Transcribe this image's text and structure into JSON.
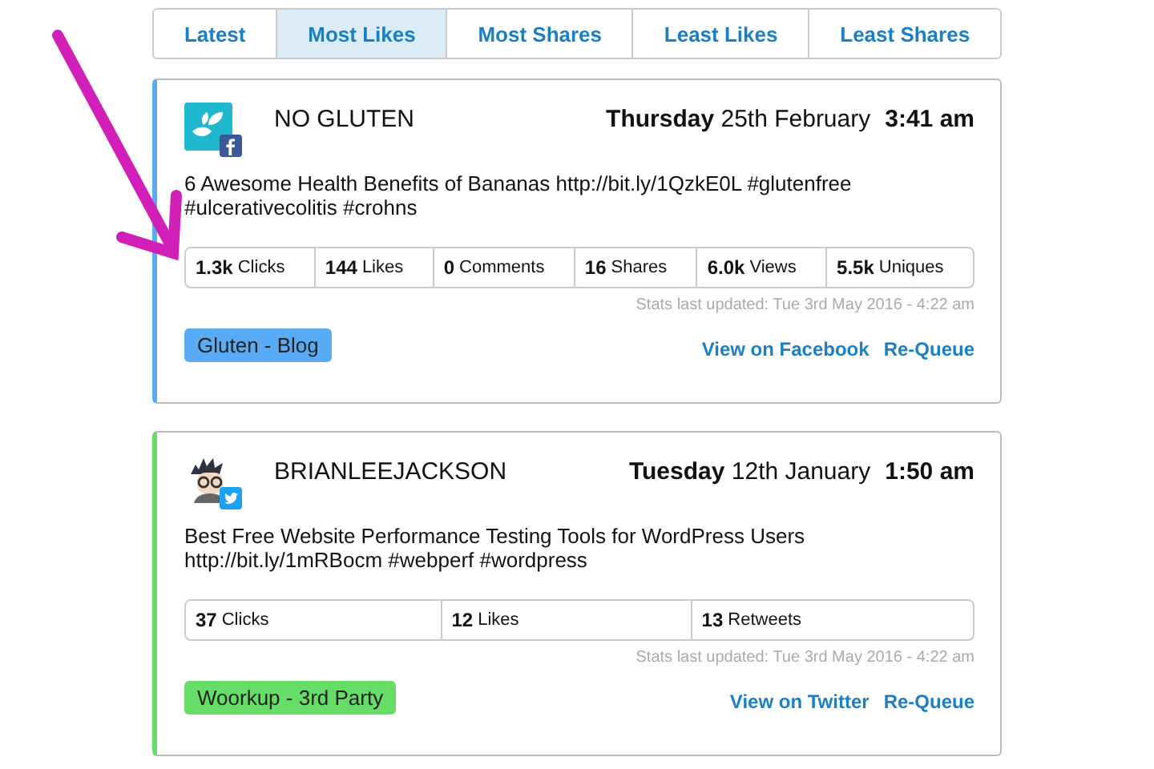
{
  "tabs": [
    {
      "label": "Latest",
      "selected": false
    },
    {
      "label": "Most Likes",
      "selected": true
    },
    {
      "label": "Most Shares",
      "selected": false
    },
    {
      "label": "Least Likes",
      "selected": false
    },
    {
      "label": "Least Shares",
      "selected": false
    }
  ],
  "posts": [
    {
      "account": "NO GLUTEN",
      "kind": "facebook",
      "color": "#5aabf5",
      "day": "Thursday",
      "date": "25th February",
      "time": "3:41 am",
      "text": "6 Awesome Health Benefits of Bananas http://bit.ly/1QzkE0L #glutenfree #ulcerativecolitis #crohns",
      "stats": [
        {
          "value": "1.3k",
          "label": "Clicks"
        },
        {
          "value": "144",
          "label": "Likes"
        },
        {
          "value": "0",
          "label": "Comments"
        },
        {
          "value": "16",
          "label": "Shares"
        },
        {
          "value": "6.0k",
          "label": "Views"
        },
        {
          "value": "5.5k",
          "label": "Uniques"
        }
      ],
      "updated": "Stats last updated: Tue 3rd May 2016 - 4:22 am",
      "tag": "Gluten - Blog",
      "links": [
        "View on Facebook",
        "Re-Queue"
      ]
    },
    {
      "account": "BRIANLEEJACKSON",
      "kind": "twitter",
      "color": "#66dd66",
      "day": "Tuesday",
      "date": "12th January",
      "time": "1:50 am",
      "text": "Best Free Website Performance Testing Tools for WordPress Users http://bit.ly/1mRBocm #webperf #wordpress",
      "stats": [
        {
          "value": "37",
          "label": "Clicks"
        },
        {
          "value": "12",
          "label": "Likes"
        },
        {
          "value": "13",
          "label": "Retweets"
        }
      ],
      "updated": "Stats last updated: Tue 3rd May 2016 - 4:22 am",
      "tag": "Woorkup - 3rd Party",
      "links": [
        "View on Twitter",
        "Re-Queue"
      ]
    }
  ]
}
